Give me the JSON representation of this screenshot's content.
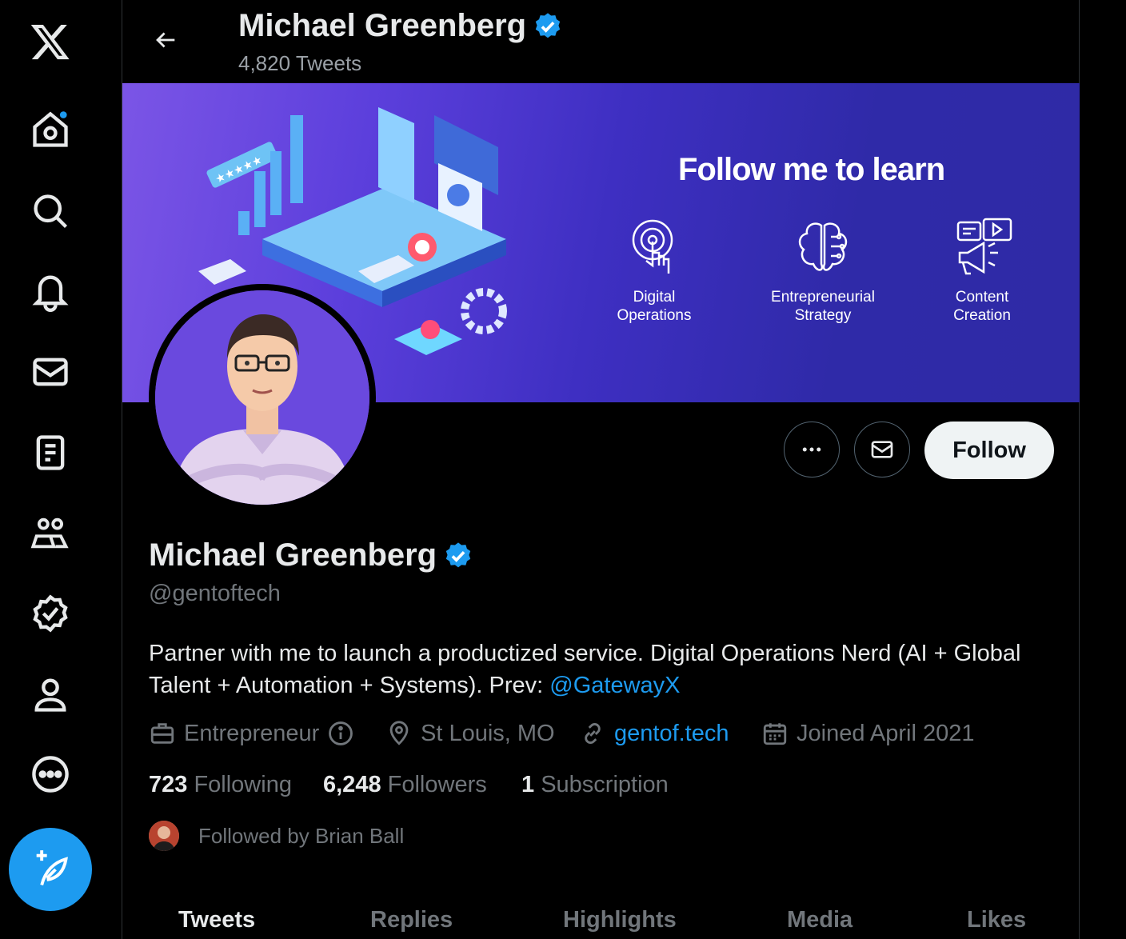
{
  "sidebar": {
    "items": [
      {
        "name": "x-logo",
        "label": "X"
      },
      {
        "name": "home-icon",
        "label": "Home"
      },
      {
        "name": "search-icon",
        "label": "Explore"
      },
      {
        "name": "bell-icon",
        "label": "Notifications"
      },
      {
        "name": "mail-icon",
        "label": "Messages"
      },
      {
        "name": "list-icon",
        "label": "Lists"
      },
      {
        "name": "communities-icon",
        "label": "Communities"
      },
      {
        "name": "verified-icon",
        "label": "Verified"
      },
      {
        "name": "profile-icon",
        "label": "Profile"
      },
      {
        "name": "more-icon",
        "label": "More"
      }
    ],
    "compose_icon": "feather-plus-icon",
    "accent": "#1d9bf0"
  },
  "header": {
    "name": "Michael Greenberg",
    "tweet_count": "4,820 Tweets"
  },
  "banner": {
    "title": "Follow me to learn",
    "features": [
      {
        "icon": "touch-target-icon",
        "line1": "Digital",
        "line2": "Operations"
      },
      {
        "icon": "brain-circuit-icon",
        "line1": "Entrepreneurial",
        "line2": "Strategy"
      },
      {
        "icon": "megaphone-video-icon",
        "line1": "Content",
        "line2": "Creation"
      }
    ]
  },
  "actions": {
    "more_icon": "more-horizontal-icon",
    "message_icon": "mail-icon",
    "follow_label": "Follow"
  },
  "profile": {
    "name": "Michael Greenberg",
    "handle": "@gentoftech",
    "bio_text": "Partner with me to launch a productized service. Digital Operations Nerd (AI + Global Talent + Automation + Systems). Prev: ",
    "bio_mention": "@GatewayX",
    "occupation": "Entrepreneur",
    "location": "St Louis, MO",
    "website": "gentof.tech",
    "joined": "Joined April 2021",
    "following_count": "723",
    "following_label": "Following",
    "followers_count": "6,248",
    "followers_label": "Followers",
    "subscription_count": "1",
    "subscription_label": "Subscription",
    "followed_by": "Followed by Brian Ball"
  },
  "tabs": [
    "Tweets",
    "Replies",
    "Highlights",
    "Media",
    "Likes"
  ],
  "active_tab": "Tweets"
}
